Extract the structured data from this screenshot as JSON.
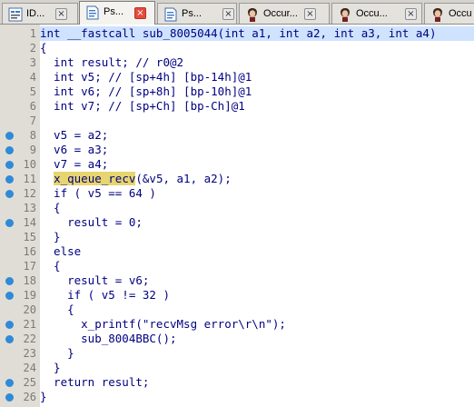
{
  "tabs": [
    {
      "label": "ID...",
      "icon": "ida-view-icon",
      "active": false
    },
    {
      "label": "Ps...",
      "icon": "pseudocode-icon",
      "active": true
    },
    {
      "label": "Ps...",
      "icon": "pseudocode-icon",
      "active": false
    },
    {
      "label": "Occur...",
      "icon": "occurrence-icon",
      "active": false
    },
    {
      "label": "Occu...",
      "icon": "occurrence-icon",
      "active": false
    },
    {
      "label": "Occu",
      "icon": "occurrence-icon",
      "active": false
    }
  ],
  "tab_close_glyph": "×",
  "code": [
    {
      "n": "1",
      "dot": false,
      "text": "int __fastcall sub_8005044(int a1, int a2, int a3, int a4)"
    },
    {
      "n": "2",
      "dot": false,
      "text": "{"
    },
    {
      "n": "3",
      "dot": false,
      "text": "  int result; // r0@2"
    },
    {
      "n": "4",
      "dot": false,
      "text": "  int v5; // [sp+4h] [bp-14h]@1"
    },
    {
      "n": "5",
      "dot": false,
      "text": "  int v6; // [sp+8h] [bp-10h]@1"
    },
    {
      "n": "6",
      "dot": false,
      "text": "  int v7; // [sp+Ch] [bp-Ch]@1"
    },
    {
      "n": "7",
      "dot": false,
      "text": ""
    },
    {
      "n": "8",
      "dot": true,
      "text": "  v5 = a2;"
    },
    {
      "n": "9",
      "dot": true,
      "text": "  v6 = a3;"
    },
    {
      "n": "10",
      "dot": true,
      "text": "  v7 = a4;"
    },
    {
      "n": "11",
      "dot": true,
      "text": "  x_queue_recv(&v5, a1, a2);"
    },
    {
      "n": "12",
      "dot": true,
      "text": "  if ( v5 == 64 )"
    },
    {
      "n": "13",
      "dot": false,
      "text": "  {"
    },
    {
      "n": "14",
      "dot": true,
      "text": "    result = 0;"
    },
    {
      "n": "15",
      "dot": false,
      "text": "  }"
    },
    {
      "n": "16",
      "dot": false,
      "text": "  else"
    },
    {
      "n": "17",
      "dot": false,
      "text": "  {"
    },
    {
      "n": "18",
      "dot": true,
      "text": "    result = v6;"
    },
    {
      "n": "19",
      "dot": true,
      "text": "    if ( v5 != 32 )"
    },
    {
      "n": "20",
      "dot": false,
      "text": "    {"
    },
    {
      "n": "21",
      "dot": true,
      "text": "      x_printf(\"recvMsg error\\r\\n\");"
    },
    {
      "n": "22",
      "dot": true,
      "text": "      sub_8004BBC();"
    },
    {
      "n": "23",
      "dot": false,
      "text": "    }"
    },
    {
      "n": "24",
      "dot": false,
      "text": "  }"
    },
    {
      "n": "25",
      "dot": true,
      "text": "  return result;"
    },
    {
      "n": "26",
      "dot": true,
      "text": "}"
    }
  ],
  "highlight": {
    "line": "1",
    "word": "x_queue_recv",
    "word_line": "11"
  },
  "colors": {
    "gutter_dot": "#2f8ad8",
    "code_text": "#000080",
    "line_highlight": "#cfe3ff",
    "word_highlight": "#e7d56f",
    "active_tab_close": "#e54b3c"
  }
}
